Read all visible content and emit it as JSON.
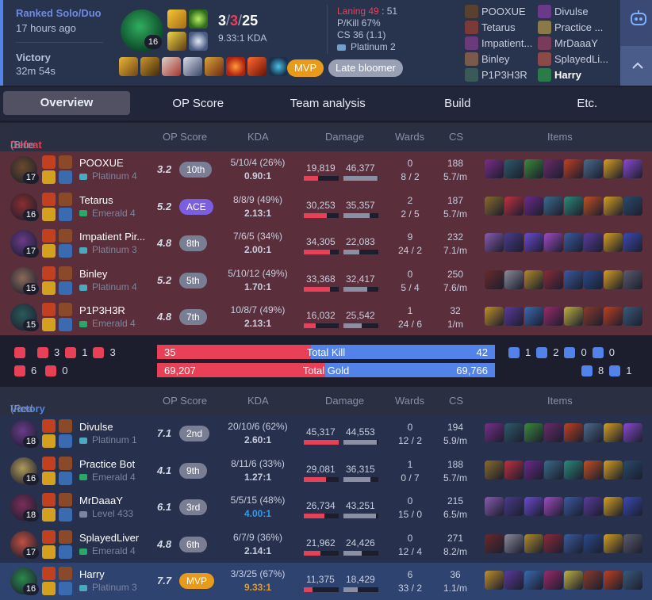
{
  "match": {
    "queue": "Ranked Solo/Duo",
    "ago": "17 hours ago",
    "result": "Victory",
    "duration": "32m 54s",
    "champion_level": "16",
    "kills": "3",
    "deaths": "3",
    "assists": "25",
    "slash": "/",
    "kda_ratio": "9.33:1 KDA",
    "laning_label": "Laning 49",
    "laning_sep": ":",
    "laning_value": "51",
    "pkill": "P/Kill 67%",
    "cs": "CS 36 (1.1)",
    "tier": "Platinum 2",
    "badges": [
      "MVP",
      "Late bloomer"
    ],
    "players_left": [
      "POOXUE",
      "Tetarus",
      "Impatient...",
      "Binley",
      "P1P3H3R"
    ],
    "players_right": [
      "Divulse",
      "Practice ...",
      "MrDaaaY",
      "SplayedLi...",
      "Harry"
    ]
  },
  "tabs": [
    "Overview",
    "OP Score",
    "Team analysis",
    "Build",
    "Etc."
  ],
  "headers": {
    "op": "OP Score",
    "kda": "KDA",
    "damage": "Damage",
    "wards": "Wards",
    "cs": "CS",
    "items": "Items"
  },
  "blue_team": {
    "result": "Defeat",
    "name": "(Blue Team)",
    "players": [
      {
        "name": "POOXUE",
        "tier": "Platinum 4",
        "level": "17",
        "score": "3.2",
        "badge": "10th",
        "kda": "5/10/4 (26%)",
        "ratio": "0.90:1",
        "dealt": "19,819",
        "taken": "46,377",
        "dealt_pct": 0.41,
        "taken_pct": 0.97,
        "wards": "0",
        "wards2": "8 / 2",
        "cs": "188",
        "csm": "5.7/m"
      },
      {
        "name": "Tetarus",
        "tier": "Emerald 4",
        "level": "16",
        "score": "5.2",
        "badge": "ACE",
        "kda": "8/8/9 (49%)",
        "ratio": "2.13:1",
        "dealt": "30,253",
        "taken": "35,357",
        "dealt_pct": 0.66,
        "taken_pct": 0.74,
        "wards": "2",
        "wards2": "2 / 5",
        "cs": "187",
        "csm": "5.7/m"
      },
      {
        "name": "Impatient Pir...",
        "tier": "Platinum 3",
        "level": "17",
        "score": "4.8",
        "badge": "8th",
        "kda": "7/6/5 (34%)",
        "ratio": "2.00:1",
        "dealt": "34,305",
        "taken": "22,083",
        "dealt_pct": 0.76,
        "taken_pct": 0.46,
        "wards": "9",
        "wards2": "24 / 2",
        "cs": "232",
        "csm": "7.1/m"
      },
      {
        "name": "Binley",
        "tier": "Platinum 4",
        "level": "15",
        "score": "5.2",
        "badge": "5th",
        "kda": "5/10/12 (49%)",
        "ratio": "1.70:1",
        "dealt": "33,368",
        "taken": "32,417",
        "dealt_pct": 0.74,
        "taken_pct": 0.68,
        "wards": "0",
        "wards2": "5 / 4",
        "cs": "250",
        "csm": "7.6/m"
      },
      {
        "name": "P1P3H3R",
        "tier": "Emerald 4",
        "level": "15",
        "score": "4.8",
        "badge": "7th",
        "kda": "10/8/7 (49%)",
        "ratio": "2.13:1",
        "dealt": "16,032",
        "taken": "25,542",
        "dealt_pct": 0.34,
        "taken_pct": 0.53,
        "wards": "1",
        "wards2": "24 / 6",
        "cs": "32",
        "csm": "1/m"
      }
    ]
  },
  "totals": {
    "blue_obj": [
      "3",
      "1",
      "3"
    ],
    "blue_obj2": [
      "6",
      "0"
    ],
    "red_obj": [
      "1",
      "2",
      "0",
      "0"
    ],
    "red_obj2": [
      "8",
      "1"
    ],
    "kills_left": "35",
    "kills_label": "Total Kill",
    "kills_right": "42",
    "gold_left": "69,207",
    "gold_label": "Total Gold",
    "gold_right": "69,766",
    "kill_left_frac": 0.455,
    "gold_left_frac": 0.498
  },
  "red_team": {
    "result": "Victory",
    "name": "(Red Team)",
    "players": [
      {
        "name": "Divulse",
        "tier": "Platinum 1",
        "level": "18",
        "score": "7.1",
        "badge": "2nd",
        "kda": "20/10/6 (62%)",
        "ratio": "2.60:1",
        "dealt": "45,317",
        "taken": "44,553",
        "dealt_pct": 1.0,
        "taken_pct": 0.96,
        "wards": "0",
        "wards2": "12 / 2",
        "cs": "194",
        "csm": "5.9/m"
      },
      {
        "name": "Practice Bot",
        "tier": "Emerald 4",
        "level": "16",
        "score": "4.1",
        "badge": "9th",
        "kda": "8/11/6 (33%)",
        "ratio": "1.27:1",
        "dealt": "29,081",
        "taken": "36,315",
        "dealt_pct": 0.64,
        "taken_pct": 0.78,
        "wards": "1",
        "wards2": "0 / 7",
        "cs": "188",
        "csm": "5.7/m"
      },
      {
        "name": "MrDaaaY",
        "tier": "Level 433",
        "level": "18",
        "score": "6.1",
        "badge": "3rd",
        "kda": "5/5/15 (48%)",
        "ratio": "4.00:1",
        "dealt": "26,734",
        "taken": "43,251",
        "dealt_pct": 0.59,
        "taken_pct": 0.93,
        "wards": "0",
        "wards2": "15 / 0",
        "cs": "215",
        "csm": "6.5/m"
      },
      {
        "name": "SplayedLiver",
        "tier": "Emerald 4",
        "level": "17",
        "score": "4.8",
        "badge": "6th",
        "kda": "6/7/9 (36%)",
        "ratio": "2.14:1",
        "dealt": "21,962",
        "taken": "24,426",
        "dealt_pct": 0.48,
        "taken_pct": 0.53,
        "wards": "0",
        "wards2": "12 / 4",
        "cs": "271",
        "csm": "8.2/m"
      },
      {
        "name": "Harry",
        "tier": "Platinum 3",
        "level": "16",
        "score": "7.7",
        "badge": "MVP",
        "kda": "3/3/25 (67%)",
        "ratio": "9.33:1",
        "dealt": "11,375",
        "taken": "18,429",
        "dealt_pct": 0.25,
        "taken_pct": 0.4,
        "wards": "6",
        "wards2": "33 / 2",
        "cs": "36",
        "csm": "1.1/m"
      }
    ]
  }
}
